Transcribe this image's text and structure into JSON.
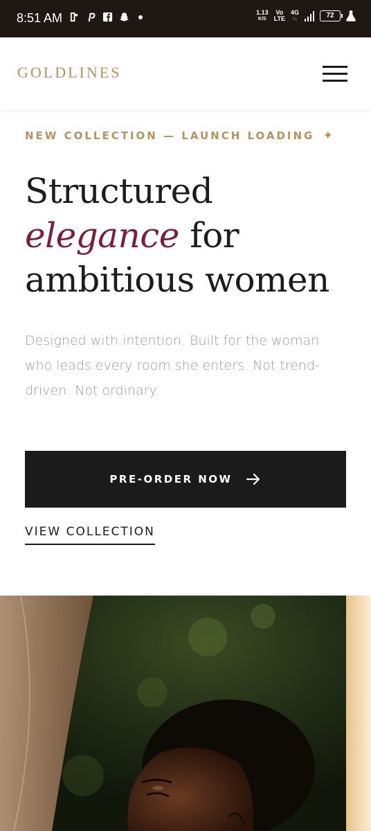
{
  "status_bar": {
    "time": "8:51 AM",
    "net_speed_value": "1.13",
    "net_speed_unit": "K/S",
    "volte_top": "Vo",
    "volte_bottom": "LTE",
    "network": "4G",
    "battery": "72",
    "notification_icons": [
      "bluesky-icon",
      "pinterest-icon",
      "facebook-icon",
      "snapchat-icon",
      "more-dot-icon"
    ]
  },
  "header": {
    "logo": "GOLDLINES",
    "menu_icon": "hamburger-menu-icon"
  },
  "hero": {
    "eyebrow": "NEW COLLECTION — LAUNCH LOADING",
    "eyebrow_icon": "sparkle-icon",
    "headline_part1": "Structured ",
    "headline_accent": "elegance",
    "headline_part2": " for ambitious women",
    "description": "Designed with intention. Built for the woman who leads every room she enters. Not trend-driven. Not ordinary.",
    "primary_cta": "PRE-ORDER NOW",
    "primary_cta_icon": "arrow-right-icon",
    "secondary_cta": "VIEW COLLECTION"
  },
  "colors": {
    "gold": "#b8915a",
    "burgundy": "#7d1d3a",
    "dark": "#1b1b1b",
    "muted": "#9a9a9a",
    "status_bar": "#1f1712"
  }
}
